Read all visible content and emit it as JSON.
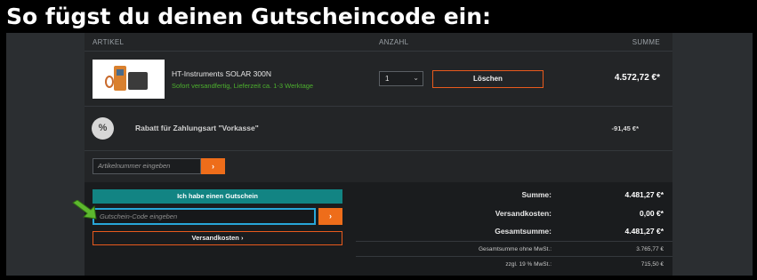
{
  "banner": {
    "title": "So fügst du deinen Gutscheincode ein:"
  },
  "columns": {
    "artikel": "ARTIKEL",
    "anzahl": "ANZAHL",
    "summe": "SUMME"
  },
  "product": {
    "name": "HT-Instruments SOLAR 300N",
    "shipping": "Sofort versandfertig, Lieferzeit ca. 1-3 Werktage",
    "quantity": "1",
    "delete_label": "Löschen",
    "price": "4.572,72 €*"
  },
  "discount": {
    "icon_text": "%",
    "label": "Rabatt für Zahlungsart \"Vorkasse\"",
    "value": "-91,45 €*"
  },
  "article_input": {
    "placeholder": "Artikelnummer eingeben",
    "submit": "›"
  },
  "voucher": {
    "toggle_label": "Ich habe einen Gutschein",
    "placeholder": "Gutschein-Code eingeben",
    "submit": "›",
    "shipping_label": "Versandkosten ›"
  },
  "summary": {
    "sum_label": "Summe:",
    "sum_value": "4.481,27 €*",
    "shipping_label": "Versandkosten:",
    "shipping_value": "0,00 €*",
    "total_label": "Gesamtsumme:",
    "total_value": "4.481,27 €*",
    "net_label": "Gesamtsumme ohne MwSt.:",
    "net_value": "3.765,77 €",
    "vat_label": "zzgl. 19 % MwSt.:",
    "vat_value": "715,50 €"
  },
  "colors": {
    "accent": "#ee6d1a",
    "teal": "#128483",
    "focus": "#28a6d8",
    "in_stock": "#4caf2e"
  },
  "icons": {
    "pointer": "green-arrow-icon",
    "dropdown": "chevron-down-icon"
  }
}
